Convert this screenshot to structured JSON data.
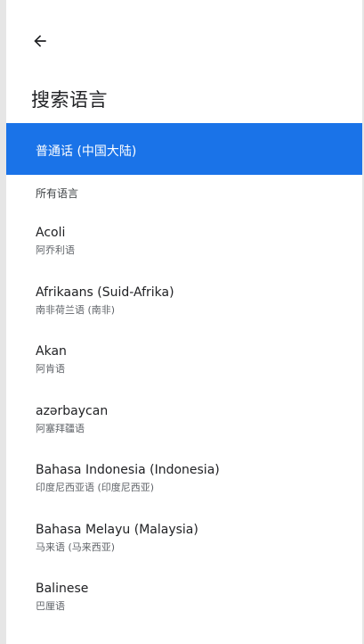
{
  "header": {
    "title": "搜索语言"
  },
  "selected": {
    "label": "普通话 (中国大陆)"
  },
  "section": {
    "all_languages_label": "所有语言"
  },
  "languages": [
    {
      "name": "Acoli",
      "native": "阿乔利语"
    },
    {
      "name": "Afrikaans (Suid-Afrika)",
      "native": "南非荷兰语 (南非)"
    },
    {
      "name": "Akan",
      "native": "阿肯语"
    },
    {
      "name": "azərbaycan",
      "native": "阿塞拜疆语"
    },
    {
      "name": "Bahasa Indonesia (Indonesia)",
      "native": "印度尼西亚语 (印度尼西亚)"
    },
    {
      "name": "Bahasa Melayu (Malaysia)",
      "native": "马来语 (马来西亚)"
    },
    {
      "name": "Balinese",
      "native": "巴厘语"
    }
  ],
  "colors": {
    "accent": "#1a73e8"
  },
  "icons": {
    "back": "arrow-back-icon"
  }
}
